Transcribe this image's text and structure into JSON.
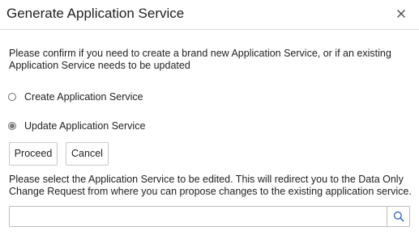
{
  "dialog": {
    "title": "Generate Application Service",
    "close_icon": "close-icon",
    "description": "Please confirm if you need to create a brand new Application Service, or if an existing Application Service needs to be updated",
    "options": [
      {
        "label": "Create Application Service",
        "selected": false
      },
      {
        "label": "Update Application Service",
        "selected": true
      }
    ],
    "buttons": {
      "proceed_label": "Proceed",
      "cancel_label": "Cancel"
    },
    "help_text": "Please select the Application Service to be edited. This will redirect you to the Data Only Change Request from where you can propose changes to the existing application service.",
    "search": {
      "value": "",
      "placeholder": "",
      "icon": "search-icon"
    },
    "colors": {
      "border": "#dcdcdc",
      "text": "#222222",
      "search_icon": "#3d6fb6"
    }
  }
}
